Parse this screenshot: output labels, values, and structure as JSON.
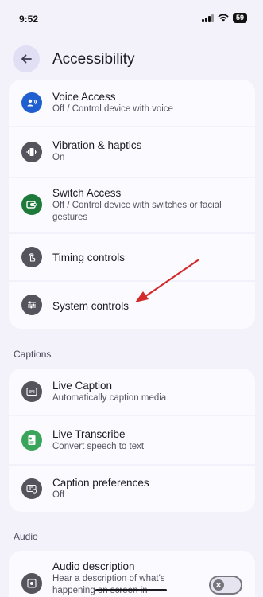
{
  "status_bar": {
    "time": "9:52",
    "battery": "59"
  },
  "header": {
    "title": "Accessibility"
  },
  "top_items": [
    {
      "title": "Voice Access",
      "subtitle": "Off / Control device with voice"
    },
    {
      "title": "Vibration & haptics",
      "subtitle": "On"
    },
    {
      "title": "Switch Access",
      "subtitle": "Off / Control device with switches or facial gestures"
    },
    {
      "title": "Timing controls",
      "subtitle": ""
    },
    {
      "title": "System controls",
      "subtitle": ""
    }
  ],
  "captions": {
    "label": "Captions",
    "items": [
      {
        "title": "Live Caption",
        "subtitle": "Automatically caption media"
      },
      {
        "title": "Live Transcribe",
        "subtitle": "Convert speech to text"
      },
      {
        "title": "Caption preferences",
        "subtitle": "Off"
      }
    ]
  },
  "audio": {
    "label": "Audio",
    "items": [
      {
        "title": "Audio description",
        "subtitle": "Hear a description of what's happening on screen in",
        "toggle_on": false
      }
    ]
  },
  "colors": {
    "background": "#f3f1fa",
    "card": "#fbfaff",
    "annotation_arrow": "#d32a2a"
  }
}
